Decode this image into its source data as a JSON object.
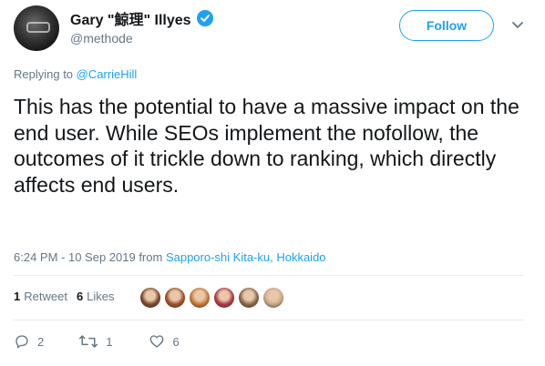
{
  "author": {
    "name": "Gary \"鯨理\" Illyes",
    "handle": "@methode",
    "verified": true
  },
  "follow_label": "Follow",
  "replying_to": {
    "prefix": "Replying to ",
    "user": "@CarrieHill"
  },
  "tweet_text": "This has the potential to have a massive impact on the end user. While SEOs implement the nofollow, the outcomes of it trickle down to ranking, which directly affects end users.",
  "timestamp": "6:24 PM - 10 Sep 2019",
  "location_prefix": " from ",
  "location": "Sapporo-shi Kita-ku, Hokkaido",
  "stats": {
    "retweets_count": "1",
    "retweets_label": "Retweet",
    "likes_count": "6",
    "likes_label": "Likes"
  },
  "likers": [
    {
      "color": "#7a4a2e"
    },
    {
      "color": "#a0522d"
    },
    {
      "color": "#c47a3a"
    },
    {
      "color": "#b03a4a"
    },
    {
      "color": "#8a6a4a"
    },
    {
      "color": "#c9a98a"
    }
  ],
  "actions": {
    "reply_count": "2",
    "retweet_count": "1",
    "like_count": "6"
  },
  "colors": {
    "accent": "#1da1f2",
    "secondary_text": "#657786",
    "divider": "#e6ecf0"
  }
}
